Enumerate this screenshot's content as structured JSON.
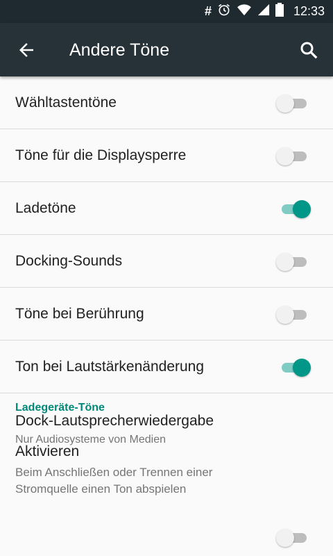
{
  "status_bar": {
    "time": "12:33",
    "icons": [
      "hash-icon",
      "alarm-icon",
      "wifi-icon",
      "signal-icon",
      "battery-icon"
    ]
  },
  "app_bar": {
    "title": "Andere Töne",
    "back_icon": "arrow-back-icon",
    "search_icon": "search-icon"
  },
  "settings": [
    {
      "label": "Wähltastentöne",
      "checked": false
    },
    {
      "label": "Töne für die Displaysperre",
      "checked": false
    },
    {
      "label": "Ladetöne",
      "checked": true
    },
    {
      "label": "Docking-Sounds",
      "checked": false
    },
    {
      "label": "Töne bei Berührung",
      "checked": false
    },
    {
      "label": "Ton bei Lautstärkenänderung",
      "checked": true
    }
  ],
  "dock_playback": {
    "label": "Dock-Lautsprecherwiedergabe",
    "summary": "Nur Audiosysteme von Medien"
  },
  "section_header": "Ladegeräte-Töne",
  "activate": {
    "label": "Aktivieren",
    "summary": "Beim Anschließen oder Trennen einer Stromquelle einen Ton abspielen",
    "checked": false
  },
  "colors": {
    "app_bar": "#263238",
    "status_bar": "#1f2a30",
    "accent": "#009688",
    "accent_track": "#80cbc4"
  }
}
